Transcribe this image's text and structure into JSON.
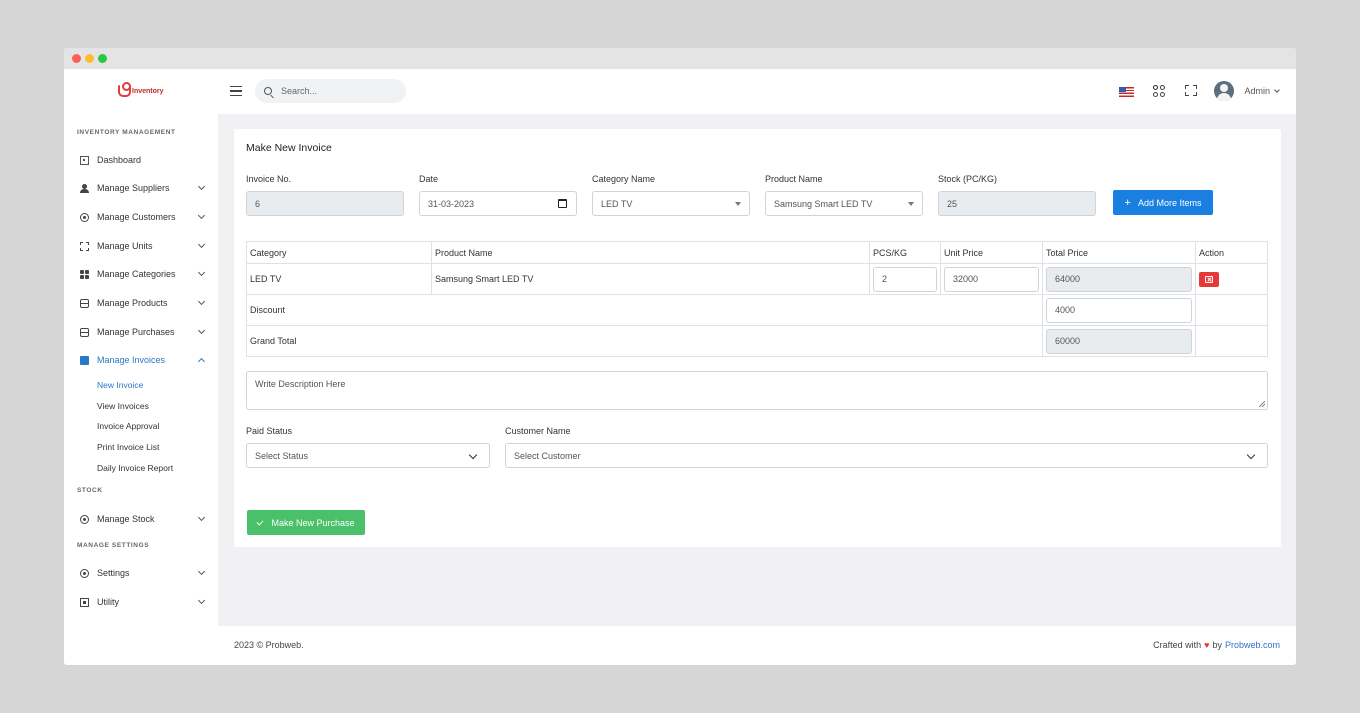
{
  "app": {
    "logo_text": "Inventory"
  },
  "topbar": {
    "search_placeholder": "Search...",
    "user_name": "Admin"
  },
  "sidebar": {
    "sections": [
      {
        "title": "INVENTORY MANAGEMENT"
      },
      {
        "title": "STOCK"
      },
      {
        "title": "MANAGE SETTINGS"
      }
    ],
    "items": [
      {
        "label": "Dashboard",
        "icon": "dashboard-icon"
      },
      {
        "label": "Manage Suppliers",
        "icon": "user-icon"
      },
      {
        "label": "Manage Customers",
        "icon": "customers-icon"
      },
      {
        "label": "Manage Units",
        "icon": "units-icon"
      },
      {
        "label": "Manage Categories",
        "icon": "categories-icon"
      },
      {
        "label": "Manage Products",
        "icon": "products-icon"
      },
      {
        "label": "Manage Purchases",
        "icon": "purchases-icon"
      },
      {
        "label": "Manage Invoices",
        "icon": "invoices-icon",
        "active": true
      },
      {
        "label": "Manage Stock",
        "icon": "stock-icon"
      },
      {
        "label": "Settings",
        "icon": "settings-icon"
      },
      {
        "label": "Utility",
        "icon": "utility-icon"
      }
    ],
    "sub_items": [
      {
        "label": "New Invoice",
        "active": true
      },
      {
        "label": "View Invoices"
      },
      {
        "label": "Invoice Approval"
      },
      {
        "label": "Print Invoice List"
      },
      {
        "label": "Daily Invoice Report"
      }
    ]
  },
  "form": {
    "title": "Make New Invoice",
    "invoice_no_label": "Invoice No.",
    "invoice_no_value": "6",
    "date_label": "Date",
    "date_value": "31-03-2023",
    "category_label": "Category Name",
    "category_value": "LED TV",
    "product_label": "Product Name",
    "product_value": "Samsung Smart LED TV",
    "stock_label": "Stock (PC/KG)",
    "stock_value": "25",
    "add_button": "Add More Items",
    "table": {
      "headers": [
        "Category",
        "Product Name",
        "PCS/KG",
        "Unit Price",
        "Total Price",
        "Action"
      ],
      "row": {
        "category": "LED TV",
        "product": "Samsung Smart LED TV",
        "qty": "2",
        "unit_price": "32000",
        "total": "64000"
      },
      "discount_label": "Discount",
      "discount_value": "4000",
      "grand_total_label": "Grand Total",
      "grand_total_value": "60000"
    },
    "description_placeholder": "Write Description Here",
    "paid_status_label": "Paid Status",
    "paid_status_value": "Select Status",
    "customer_label": "Customer Name",
    "customer_value": "Select Customer",
    "submit_button": "Make New Purchase"
  },
  "footer": {
    "copyright": "2023 © Probweb.",
    "crafted_prefix": "Crafted with",
    "heart": "♥",
    "by": "by",
    "link_text": "Probweb.com"
  },
  "colors": {
    "primary": "#1a7fe0",
    "success": "#4ac06b",
    "danger": "#e53935",
    "active_link": "#2a76c9"
  }
}
